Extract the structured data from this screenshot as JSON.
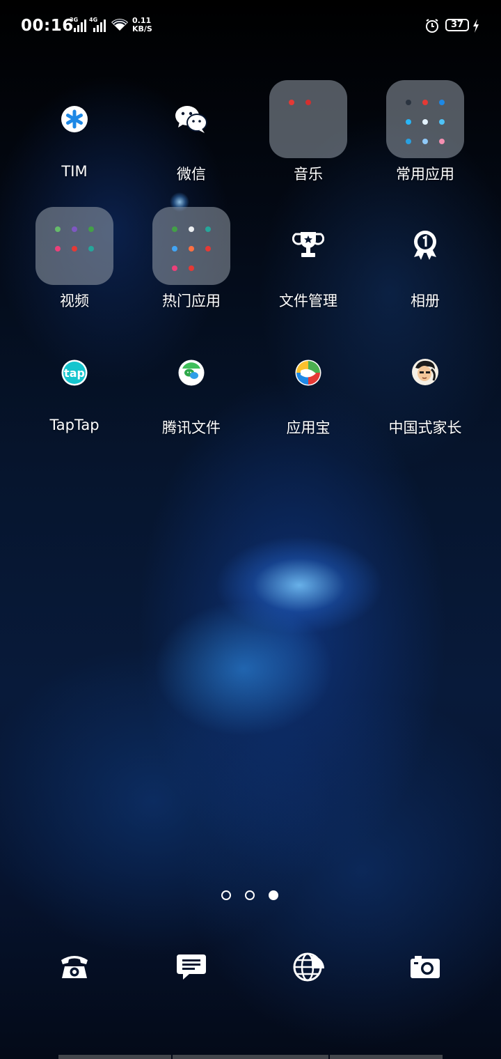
{
  "status_bar": {
    "time": "00:16",
    "signal1_type": "3G",
    "signal2_type": "4G",
    "net_speed_value": "0.11",
    "net_speed_unit": "KB/S",
    "battery": "37"
  },
  "apps": [
    {
      "label": "TIM",
      "icon": "tim-icon"
    },
    {
      "label": "微信",
      "icon": "wechat-icon"
    },
    {
      "label": "音乐",
      "icon": "folder-icon"
    },
    {
      "label": "常用应用",
      "icon": "folder-icon"
    },
    {
      "label": "视频",
      "icon": "folder-icon"
    },
    {
      "label": "热门应用",
      "icon": "folder-icon"
    },
    {
      "label": "文件管理",
      "icon": "trophy-icon"
    },
    {
      "label": "相册",
      "icon": "medal-icon"
    },
    {
      "label": "TapTap",
      "icon": "taptap-icon"
    },
    {
      "label": "腾讯文件",
      "icon": "tencent-files-icon"
    },
    {
      "label": "应用宝",
      "icon": "app-store-icon"
    },
    {
      "label": "中国式家长",
      "icon": "game-avatar-icon"
    }
  ],
  "page_indicator": {
    "count": 3,
    "active": 3
  },
  "dock": [
    {
      "icon": "phone-icon"
    },
    {
      "icon": "messages-icon"
    },
    {
      "icon": "browser-icon"
    },
    {
      "icon": "camera-icon"
    }
  ],
  "colors": {
    "accent": "#1e88e5",
    "folder": "#8a929c"
  }
}
